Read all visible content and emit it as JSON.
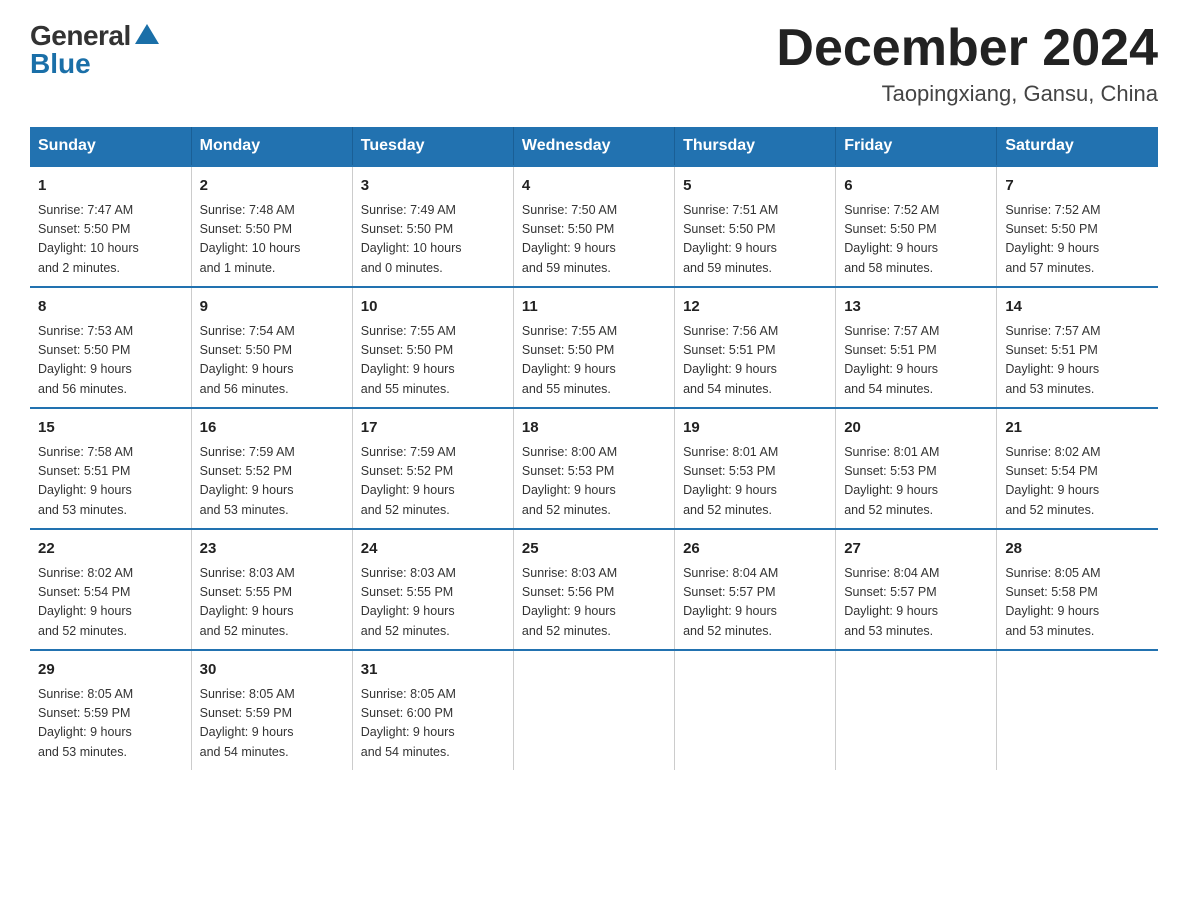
{
  "header": {
    "logo_general": "General",
    "logo_blue": "Blue",
    "month_title": "December 2024",
    "subtitle": "Taopingxiang, Gansu, China"
  },
  "days_of_week": [
    "Sunday",
    "Monday",
    "Tuesday",
    "Wednesday",
    "Thursday",
    "Friday",
    "Saturday"
  ],
  "weeks": [
    [
      {
        "day": "1",
        "info": "Sunrise: 7:47 AM\nSunset: 5:50 PM\nDaylight: 10 hours\nand 2 minutes."
      },
      {
        "day": "2",
        "info": "Sunrise: 7:48 AM\nSunset: 5:50 PM\nDaylight: 10 hours\nand 1 minute."
      },
      {
        "day": "3",
        "info": "Sunrise: 7:49 AM\nSunset: 5:50 PM\nDaylight: 10 hours\nand 0 minutes."
      },
      {
        "day": "4",
        "info": "Sunrise: 7:50 AM\nSunset: 5:50 PM\nDaylight: 9 hours\nand 59 minutes."
      },
      {
        "day": "5",
        "info": "Sunrise: 7:51 AM\nSunset: 5:50 PM\nDaylight: 9 hours\nand 59 minutes."
      },
      {
        "day": "6",
        "info": "Sunrise: 7:52 AM\nSunset: 5:50 PM\nDaylight: 9 hours\nand 58 minutes."
      },
      {
        "day": "7",
        "info": "Sunrise: 7:52 AM\nSunset: 5:50 PM\nDaylight: 9 hours\nand 57 minutes."
      }
    ],
    [
      {
        "day": "8",
        "info": "Sunrise: 7:53 AM\nSunset: 5:50 PM\nDaylight: 9 hours\nand 56 minutes."
      },
      {
        "day": "9",
        "info": "Sunrise: 7:54 AM\nSunset: 5:50 PM\nDaylight: 9 hours\nand 56 minutes."
      },
      {
        "day": "10",
        "info": "Sunrise: 7:55 AM\nSunset: 5:50 PM\nDaylight: 9 hours\nand 55 minutes."
      },
      {
        "day": "11",
        "info": "Sunrise: 7:55 AM\nSunset: 5:50 PM\nDaylight: 9 hours\nand 55 minutes."
      },
      {
        "day": "12",
        "info": "Sunrise: 7:56 AM\nSunset: 5:51 PM\nDaylight: 9 hours\nand 54 minutes."
      },
      {
        "day": "13",
        "info": "Sunrise: 7:57 AM\nSunset: 5:51 PM\nDaylight: 9 hours\nand 54 minutes."
      },
      {
        "day": "14",
        "info": "Sunrise: 7:57 AM\nSunset: 5:51 PM\nDaylight: 9 hours\nand 53 minutes."
      }
    ],
    [
      {
        "day": "15",
        "info": "Sunrise: 7:58 AM\nSunset: 5:51 PM\nDaylight: 9 hours\nand 53 minutes."
      },
      {
        "day": "16",
        "info": "Sunrise: 7:59 AM\nSunset: 5:52 PM\nDaylight: 9 hours\nand 53 minutes."
      },
      {
        "day": "17",
        "info": "Sunrise: 7:59 AM\nSunset: 5:52 PM\nDaylight: 9 hours\nand 52 minutes."
      },
      {
        "day": "18",
        "info": "Sunrise: 8:00 AM\nSunset: 5:53 PM\nDaylight: 9 hours\nand 52 minutes."
      },
      {
        "day": "19",
        "info": "Sunrise: 8:01 AM\nSunset: 5:53 PM\nDaylight: 9 hours\nand 52 minutes."
      },
      {
        "day": "20",
        "info": "Sunrise: 8:01 AM\nSunset: 5:53 PM\nDaylight: 9 hours\nand 52 minutes."
      },
      {
        "day": "21",
        "info": "Sunrise: 8:02 AM\nSunset: 5:54 PM\nDaylight: 9 hours\nand 52 minutes."
      }
    ],
    [
      {
        "day": "22",
        "info": "Sunrise: 8:02 AM\nSunset: 5:54 PM\nDaylight: 9 hours\nand 52 minutes."
      },
      {
        "day": "23",
        "info": "Sunrise: 8:03 AM\nSunset: 5:55 PM\nDaylight: 9 hours\nand 52 minutes."
      },
      {
        "day": "24",
        "info": "Sunrise: 8:03 AM\nSunset: 5:55 PM\nDaylight: 9 hours\nand 52 minutes."
      },
      {
        "day": "25",
        "info": "Sunrise: 8:03 AM\nSunset: 5:56 PM\nDaylight: 9 hours\nand 52 minutes."
      },
      {
        "day": "26",
        "info": "Sunrise: 8:04 AM\nSunset: 5:57 PM\nDaylight: 9 hours\nand 52 minutes."
      },
      {
        "day": "27",
        "info": "Sunrise: 8:04 AM\nSunset: 5:57 PM\nDaylight: 9 hours\nand 53 minutes."
      },
      {
        "day": "28",
        "info": "Sunrise: 8:05 AM\nSunset: 5:58 PM\nDaylight: 9 hours\nand 53 minutes."
      }
    ],
    [
      {
        "day": "29",
        "info": "Sunrise: 8:05 AM\nSunset: 5:59 PM\nDaylight: 9 hours\nand 53 minutes."
      },
      {
        "day": "30",
        "info": "Sunrise: 8:05 AM\nSunset: 5:59 PM\nDaylight: 9 hours\nand 54 minutes."
      },
      {
        "day": "31",
        "info": "Sunrise: 8:05 AM\nSunset: 6:00 PM\nDaylight: 9 hours\nand 54 minutes."
      },
      {
        "day": "",
        "info": ""
      },
      {
        "day": "",
        "info": ""
      },
      {
        "day": "",
        "info": ""
      },
      {
        "day": "",
        "info": ""
      }
    ]
  ]
}
